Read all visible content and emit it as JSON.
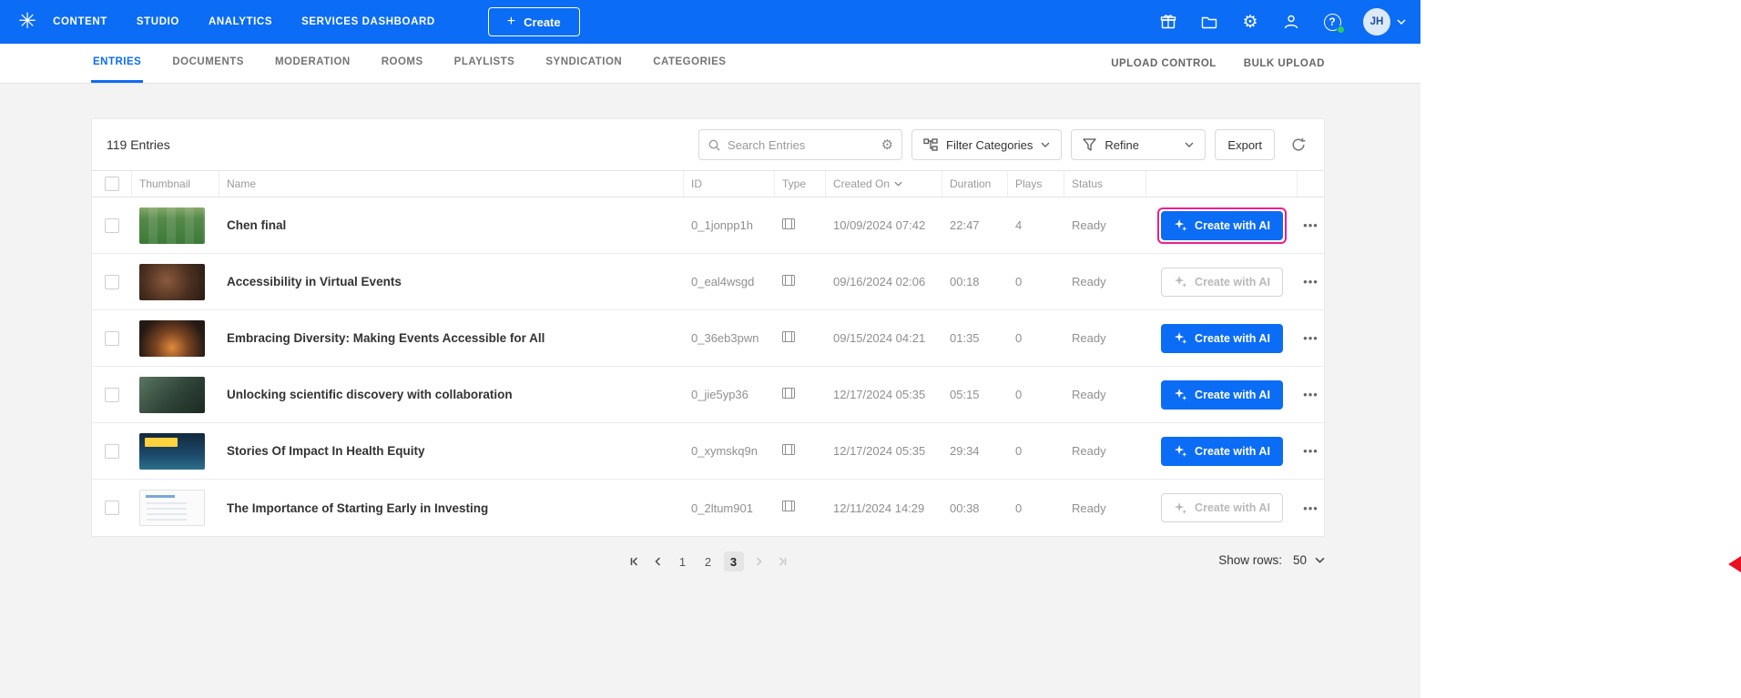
{
  "header": {
    "nav": [
      "CONTENT",
      "STUDIO",
      "ANALYTICS",
      "SERVICES DASHBOARD"
    ],
    "create_label": "Create",
    "avatar_initials": "JH"
  },
  "icons": {
    "logo": "✳",
    "plus": "+",
    "gear_white": "⚙",
    "help": "?",
    "search_gear": "⚙",
    "dots_menu": "•••"
  },
  "subnav": {
    "tabs": [
      "ENTRIES",
      "DOCUMENTS",
      "MODERATION",
      "ROOMS",
      "PLAYLISTS",
      "SYNDICATION",
      "CATEGORIES"
    ],
    "active_tab": "ENTRIES",
    "right": [
      "UPLOAD CONTROL",
      "BULK UPLOAD"
    ]
  },
  "toolbar": {
    "entries_count": "119 Entries",
    "search_placeholder": "Search Entries",
    "filter_categories_label": "Filter Categories",
    "refine_label": "Refine",
    "export_label": "Export"
  },
  "table": {
    "ai_button_label": "Create with AI",
    "headers": {
      "thumbnail": "Thumbnail",
      "name": "Name",
      "id": "ID",
      "type": "Type",
      "created_on": "Created On",
      "duration": "Duration",
      "plays": "Plays",
      "status": "Status"
    },
    "rows": [
      {
        "name": "Chen final",
        "id": "0_1jonpp1h",
        "type": "video",
        "created_on": "10/09/2024 07:42",
        "duration": "22:47",
        "plays": "4",
        "status": "Ready",
        "ai_state": "enabled",
        "highlight": true,
        "thumb": "soccer"
      },
      {
        "name": "Accessibility in Virtual Events",
        "id": "0_eal4wsgd",
        "type": "video",
        "created_on": "09/16/2024 02:06",
        "duration": "00:18",
        "plays": "0",
        "status": "Ready",
        "ai_state": "disabled",
        "highlight": false,
        "thumb": "couch"
      },
      {
        "name": "Embracing Diversity: Making Events Accessible for All",
        "id": "0_36eb3pwn",
        "type": "video",
        "created_on": "09/15/2024 04:21",
        "duration": "01:35",
        "plays": "0",
        "status": "Ready",
        "ai_state": "enabled",
        "highlight": false,
        "thumb": "campfire"
      },
      {
        "name": "Unlocking scientific discovery with collaboration",
        "id": "0_jie5yp36",
        "type": "video",
        "created_on": "12/17/2024 05:35",
        "duration": "05:15",
        "plays": "0",
        "status": "Ready",
        "ai_state": "enabled",
        "highlight": false,
        "thumb": "handshake"
      },
      {
        "name": "Stories Of Impact In Health Equity",
        "id": "0_xymskq9n",
        "type": "video",
        "created_on": "12/17/2024 05:35",
        "duration": "29:34",
        "plays": "0",
        "status": "Ready",
        "ai_state": "enabled",
        "highlight": false,
        "thumb": "impact"
      },
      {
        "name": "The Importance of Starting Early in Investing",
        "id": "0_2ltum901",
        "type": "video",
        "created_on": "12/11/2024 14:29",
        "duration": "00:38",
        "plays": "0",
        "status": "Ready",
        "ai_state": "disabled",
        "highlight": false,
        "thumb": "slide"
      }
    ]
  },
  "pagination": {
    "pages": [
      "1",
      "2",
      "3"
    ],
    "current_page": "3",
    "show_rows_label": "Show rows:",
    "show_rows_value": "50"
  },
  "colors": {
    "accent_blue": "#0b6cf5",
    "highlight_pink": "#ec1e8e",
    "online_green": "#2ecc5e",
    "marker_red": "#e81123"
  }
}
